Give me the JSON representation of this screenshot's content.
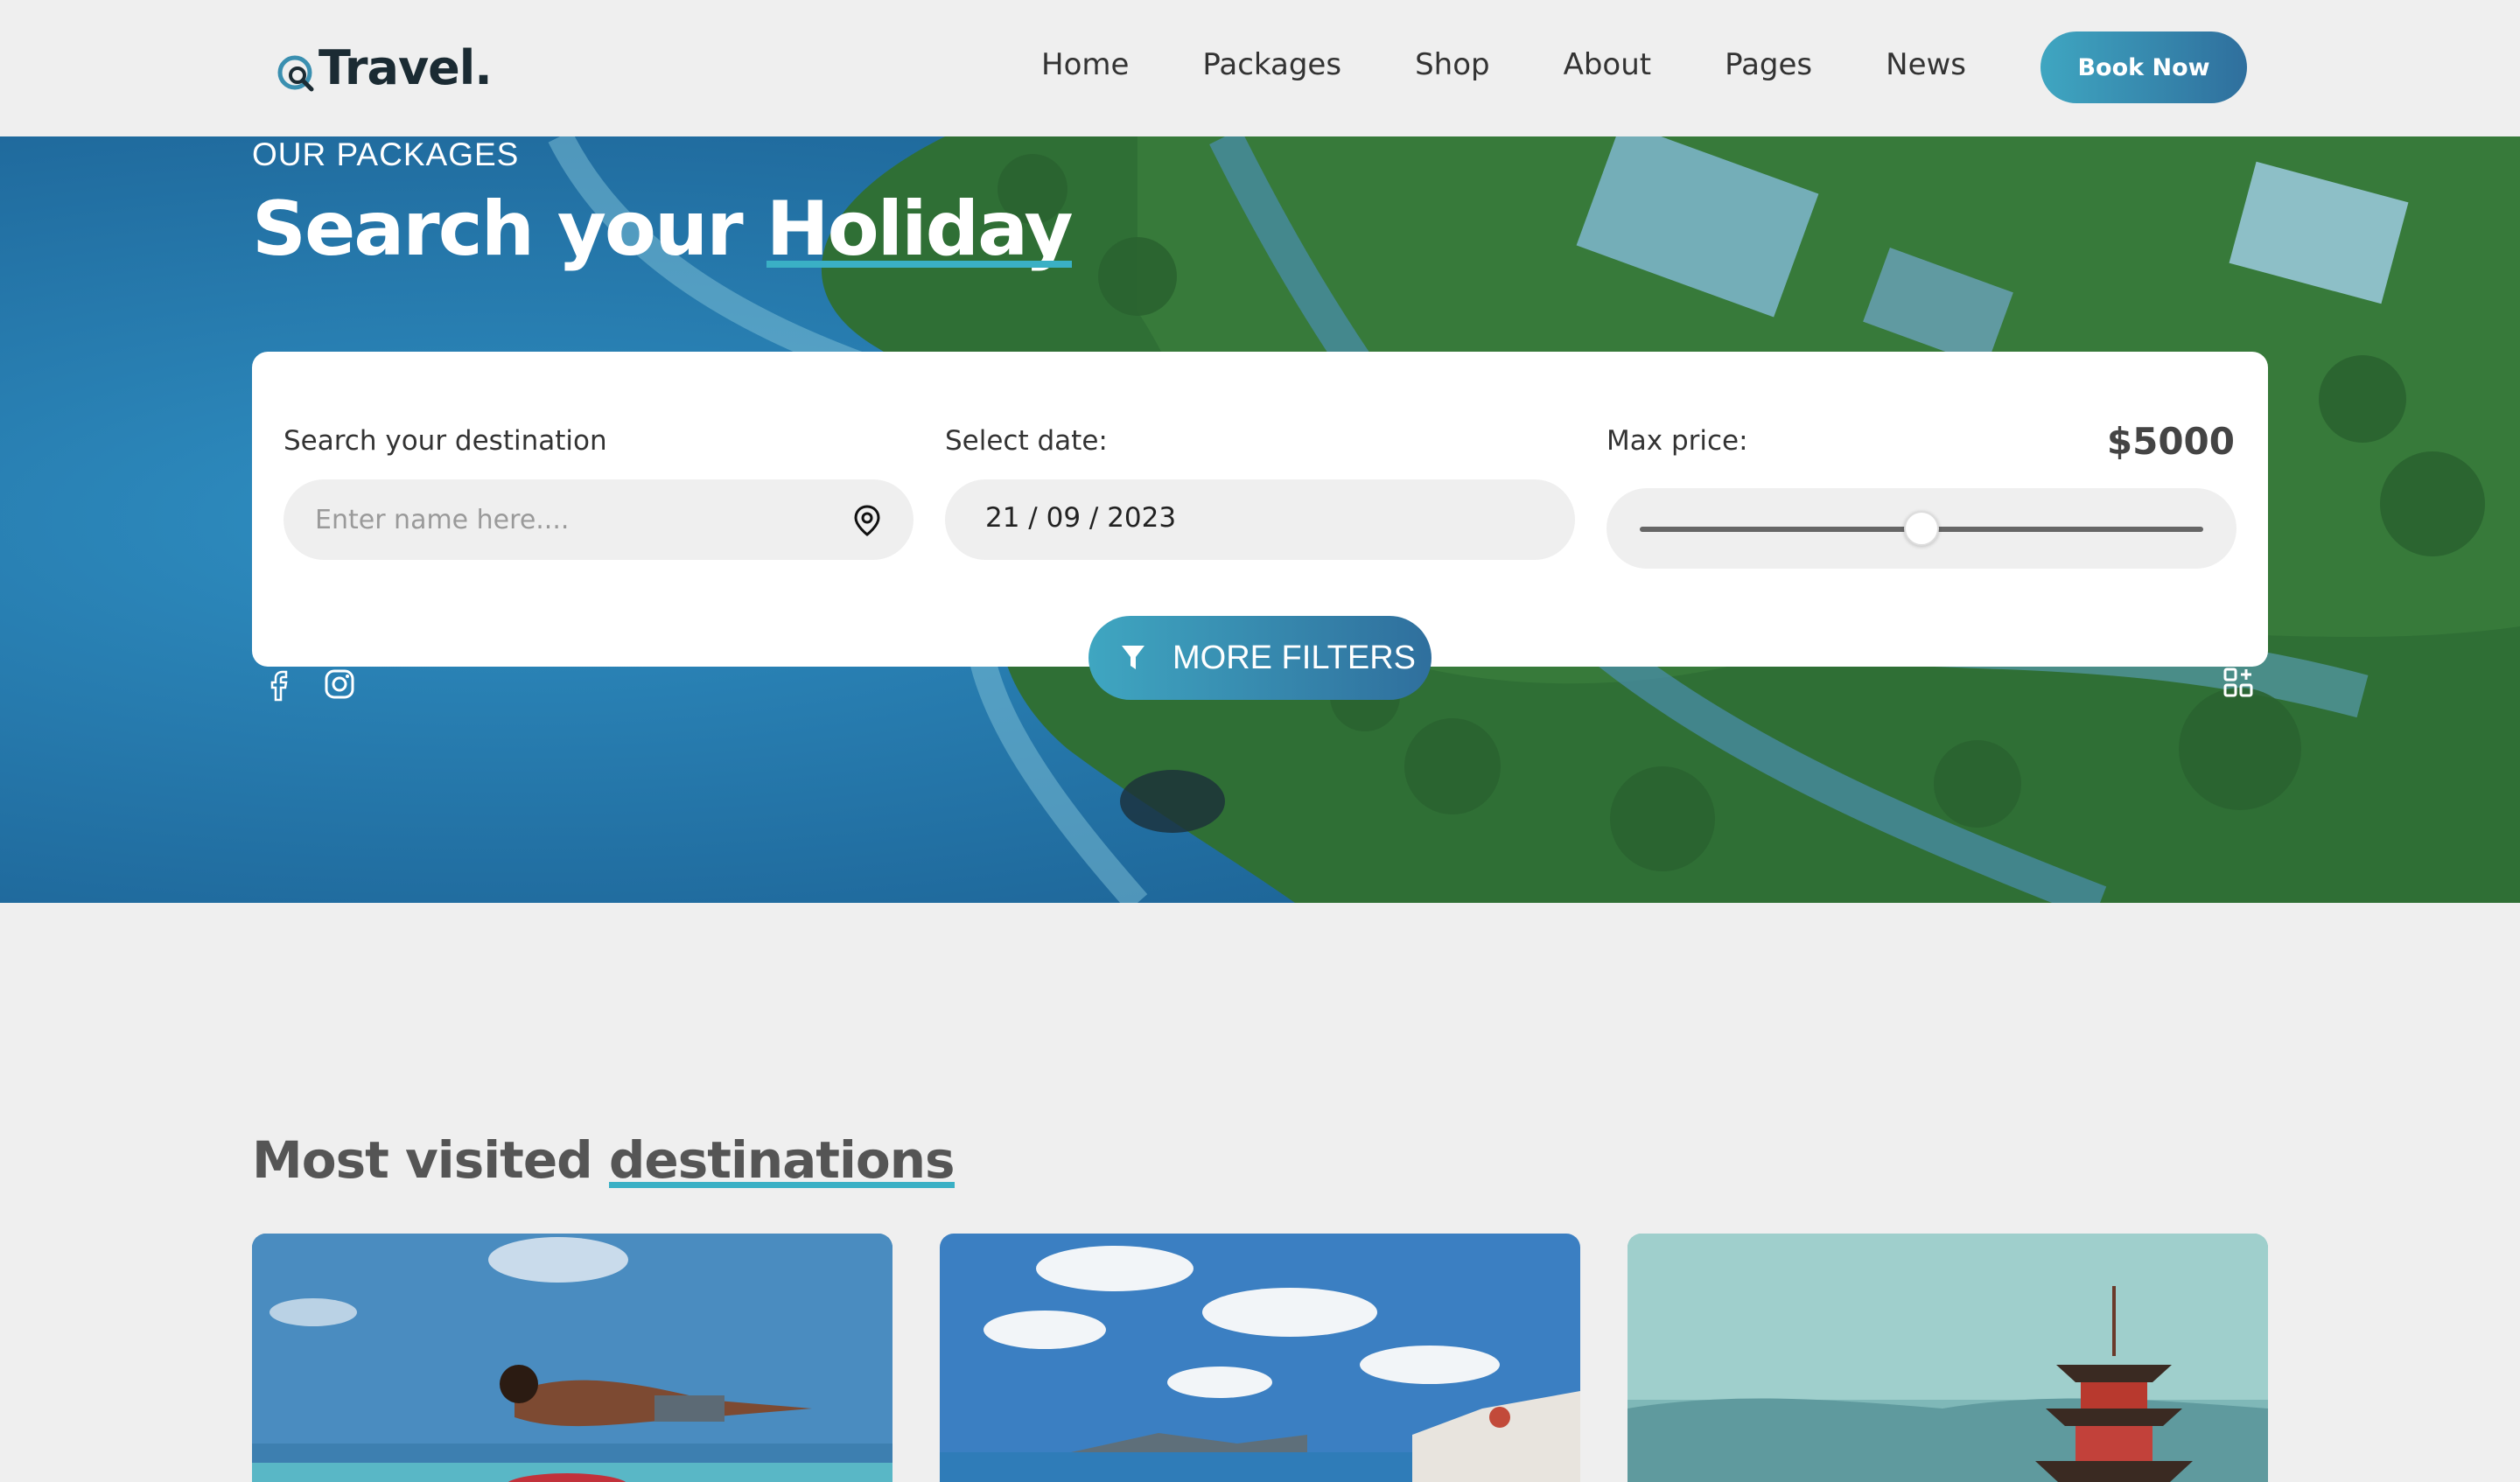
{
  "brand": {
    "name": "Travel."
  },
  "nav": {
    "items": [
      "Home",
      "Packages",
      "Shop",
      "About",
      "Pages",
      "News"
    ],
    "cta_label": "Book Now"
  },
  "hero": {
    "eyebrow": "OUR PACKAGES",
    "title_plain": "Search your",
    "title_highlight": "Holiday"
  },
  "search": {
    "destination_label": "Search your destination",
    "destination_placeholder": "Enter name here....",
    "date_label": "Select date:",
    "date_value": "21 / 09 / 2023",
    "price_label": "Max price:",
    "price_value": "$5000",
    "price_slider_fraction": 0.5,
    "more_filters_label": "MORE FILTERS"
  },
  "social": {
    "icons": [
      "facebook-icon",
      "instagram-icon"
    ]
  },
  "destinations": {
    "title_plain": "Most visited",
    "title_highlight": "destinations"
  },
  "colors": {
    "accent": "#3ab0c5",
    "button_gradient_start": "#3fa6c1",
    "button_gradient_end": "#2f6f9d",
    "background": "#efefef",
    "text_dark": "#1b2b33"
  }
}
